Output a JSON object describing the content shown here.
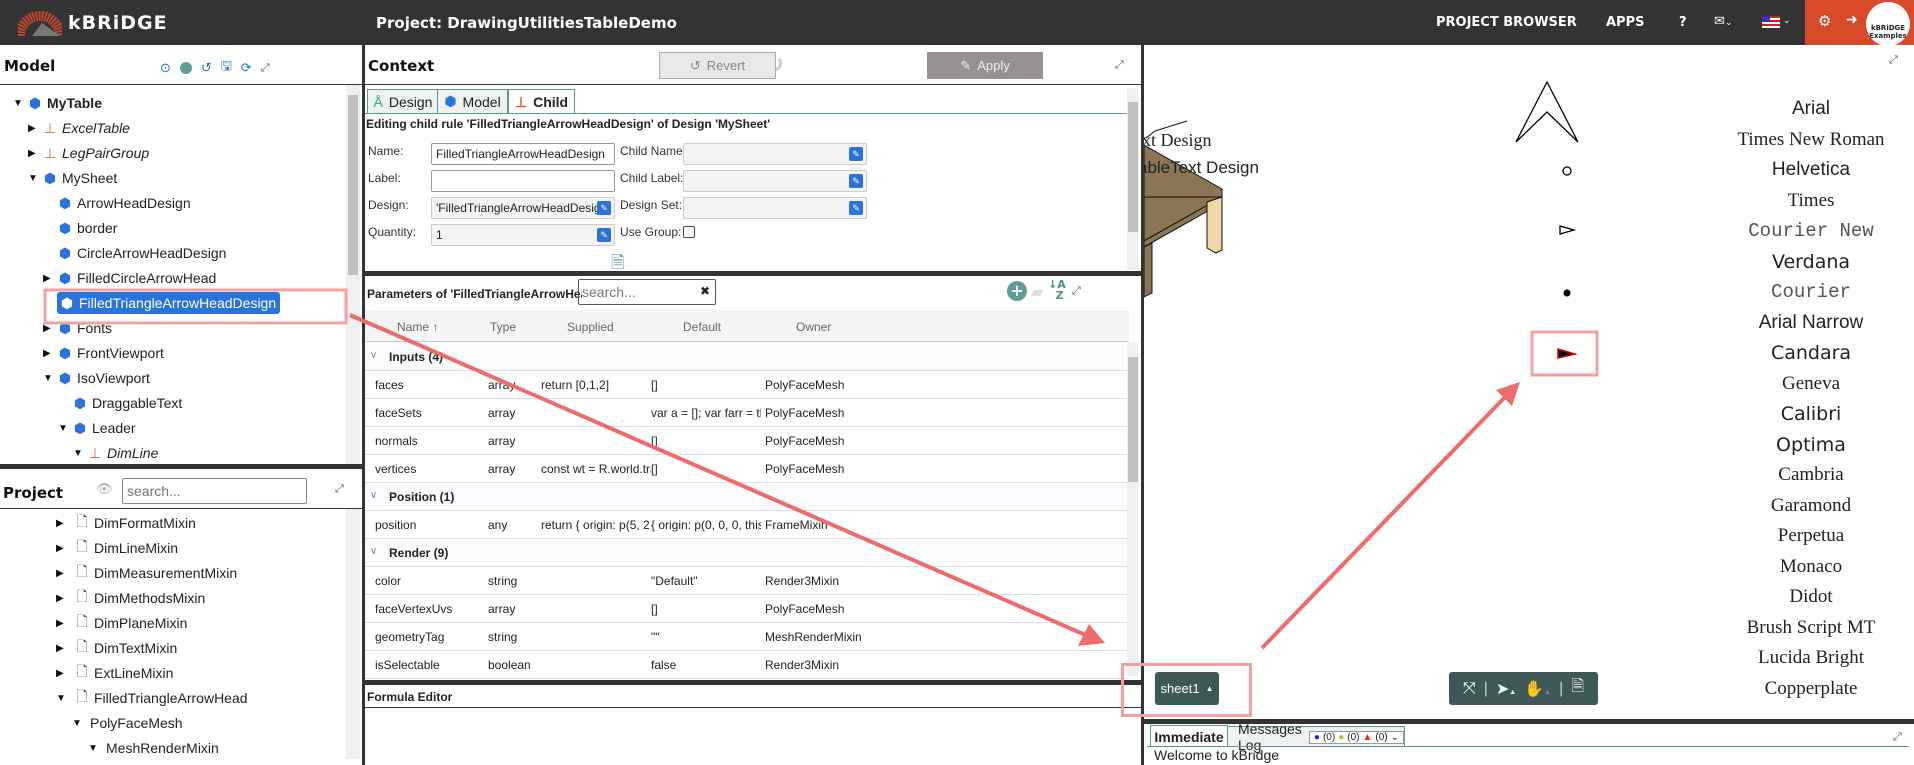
{
  "header": {
    "brand": "kBRiDGE",
    "project_title": "Project: DrawingUtilitiesTableDemo",
    "nav": [
      "PROJECT BROWSER",
      "APPS",
      "?"
    ],
    "avatar_text": "kBRiDGE Examples",
    "accent": "#d9492b"
  },
  "model": {
    "title": "Model",
    "tree": [
      {
        "label": "MyTable",
        "depth": 0,
        "toggle": "expanded",
        "kind": "design",
        "bold": true
      },
      {
        "label": "ExcelTable",
        "depth": 1,
        "toggle": "collapsed",
        "kind": "child-rule"
      },
      {
        "label": "LegPairGroup",
        "depth": 1,
        "toggle": "collapsed",
        "kind": "child-rule"
      },
      {
        "label": "MySheet",
        "depth": 1,
        "toggle": "expanded",
        "kind": "design"
      },
      {
        "label": "ArrowHeadDesign",
        "depth": 2,
        "toggle": "none",
        "kind": "design"
      },
      {
        "label": "border",
        "depth": 2,
        "toggle": "none",
        "kind": "design"
      },
      {
        "label": "CircleArrowHeadDesign",
        "depth": 2,
        "toggle": "none",
        "kind": "design"
      },
      {
        "label": "FilledCircleArrowHead",
        "depth": 2,
        "toggle": "collapsed",
        "kind": "design"
      },
      {
        "label": "FilledTriangleArrowHeadDesign",
        "depth": 2,
        "toggle": "none",
        "kind": "design",
        "selected": true
      },
      {
        "label": "Fonts",
        "depth": 2,
        "toggle": "collapsed",
        "kind": "design"
      },
      {
        "label": "FrontViewport",
        "depth": 2,
        "toggle": "collapsed",
        "kind": "design"
      },
      {
        "label": "IsoViewport",
        "depth": 2,
        "toggle": "expanded",
        "kind": "design"
      },
      {
        "label": "DraggableText",
        "depth": 3,
        "toggle": "none",
        "kind": "design"
      },
      {
        "label": "Leader",
        "depth": 3,
        "toggle": "expanded",
        "kind": "design"
      },
      {
        "label": "DimLine",
        "depth": 4,
        "toggle": "expanded",
        "kind": "child-rule"
      }
    ]
  },
  "project": {
    "title": "Project",
    "search_placeholder": "search...",
    "tree": [
      {
        "label": "DimFormatMixin",
        "depth": 0,
        "toggle": "collapsed",
        "kind": "mixin"
      },
      {
        "label": "DimLineMixin",
        "depth": 0,
        "toggle": "collapsed",
        "kind": "file"
      },
      {
        "label": "DimMeasurementMixin",
        "depth": 0,
        "toggle": "collapsed",
        "kind": "mixin"
      },
      {
        "label": "DimMethodsMixin",
        "depth": 0,
        "toggle": "collapsed",
        "kind": "mixin"
      },
      {
        "label": "DimPlaneMixin",
        "depth": 0,
        "toggle": "collapsed",
        "kind": "file"
      },
      {
        "label": "DimTextMixin",
        "depth": 0,
        "toggle": "collapsed",
        "kind": "file"
      },
      {
        "label": "ExtLineMixin",
        "depth": 0,
        "toggle": "collapsed",
        "kind": "file"
      },
      {
        "label": "FilledTriangleArrowHead",
        "depth": 0,
        "toggle": "expanded",
        "kind": "mixin"
      },
      {
        "label": "PolyFaceMesh",
        "depth": 1,
        "toggle": "expanded",
        "kind": "none"
      },
      {
        "label": "MeshRenderMixin",
        "depth": 2,
        "toggle": "expanded",
        "kind": "none"
      }
    ]
  },
  "context": {
    "title": "Context",
    "revert": "Revert",
    "apply": "Apply",
    "tabs": [
      {
        "label": "Design"
      },
      {
        "label": "Model"
      },
      {
        "label": "Child",
        "active": true
      }
    ],
    "editing_text": "Editing child rule 'FilledTriangleArrowHeadDesign' of Design 'MySheet'",
    "form": {
      "name_label": "Name:",
      "name_value": "FilledTriangleArrowHeadDesign",
      "label_label": "Label:",
      "label_value": "",
      "design_label": "Design:",
      "design_value": "'FilledTriangleArrowHeadDesign'",
      "quantity_label": "Quantity:",
      "quantity_value": "1",
      "child_name_label": "Child Name:",
      "child_label_label": "Child Label:",
      "design_set_label": "Design Set:",
      "use_group_label": "Use Group:",
      "use_group_checked": false
    }
  },
  "parameters": {
    "title": "Parameters of 'FilledTriangleArrowHeadDesign'",
    "search_placeholder": "search...",
    "columns": [
      "Name ↑",
      "Type",
      "Supplied",
      "Default",
      "Owner"
    ],
    "rows": [
      {
        "group": "Inputs (4)"
      },
      {
        "name": "faces",
        "type": "array",
        "supplied": "return [0,1,2]",
        "default": "[]",
        "owner": "PolyFaceMesh"
      },
      {
        "name": "faceSets",
        "type": "array",
        "supplied": "",
        "default": "var a = []; var farr = this.f...",
        "owner": "PolyFaceMesh"
      },
      {
        "name": "normals",
        "type": "array",
        "supplied": "",
        "default": "[]",
        "owner": "PolyFaceMesh"
      },
      {
        "name": "vertices",
        "type": "array",
        "supplied": "const wt = R.world.transf...",
        "default": "[]",
        "owner": "PolyFaceMesh"
      },
      {
        "group": "Position (1)"
      },
      {
        "name": "position",
        "type": "any",
        "supplied": "return { origin: p(5, 2, 0, t...",
        "default": "{ origin: p(0, 0, 0, this.par...",
        "owner": "FrameMixin"
      },
      {
        "group": "Render (9)"
      },
      {
        "name": "color",
        "type": "string",
        "supplied": "",
        "default": "\"Default\"",
        "owner": "Render3Mixin"
      },
      {
        "name": "faceVertexUvs",
        "type": "array",
        "supplied": "",
        "default": "[]",
        "owner": "PolyFaceMesh"
      },
      {
        "name": "geometryTag",
        "type": "string",
        "supplied": "",
        "default": "\"\"",
        "owner": "MeshRenderMixin"
      },
      {
        "name": "isSelectable",
        "type": "boolean",
        "supplied": "",
        "default": "false",
        "owner": "Render3Mixin"
      }
    ]
  },
  "formula_editor": {
    "title": "Formula Editor"
  },
  "viewport": {
    "text_line1": "ext Design",
    "text_line2": "ableText Design",
    "fonts": [
      "Arial",
      "Times New Roman",
      "Helvetica",
      "Times",
      "Courier New",
      "Verdana",
      "Courier",
      "Arial Narrow",
      "Candara",
      "Geneva",
      "Calibri",
      "Optima",
      "Cambria",
      "Garamond",
      "Perpetua",
      "Monaco",
      "Didot",
      "Brush Script MT",
      "Lucida Bright",
      "Copperplate"
    ],
    "sheet_button": "sheet1",
    "highlight_color": "#f08080",
    "filled_arrow_color": "#e00000"
  },
  "console": {
    "tabs": [
      "Immediate",
      "Messages Log"
    ],
    "info_count": "(0)",
    "warn_count": "(0)",
    "error_count": "(0)",
    "message": "Welcome to kBridge"
  }
}
